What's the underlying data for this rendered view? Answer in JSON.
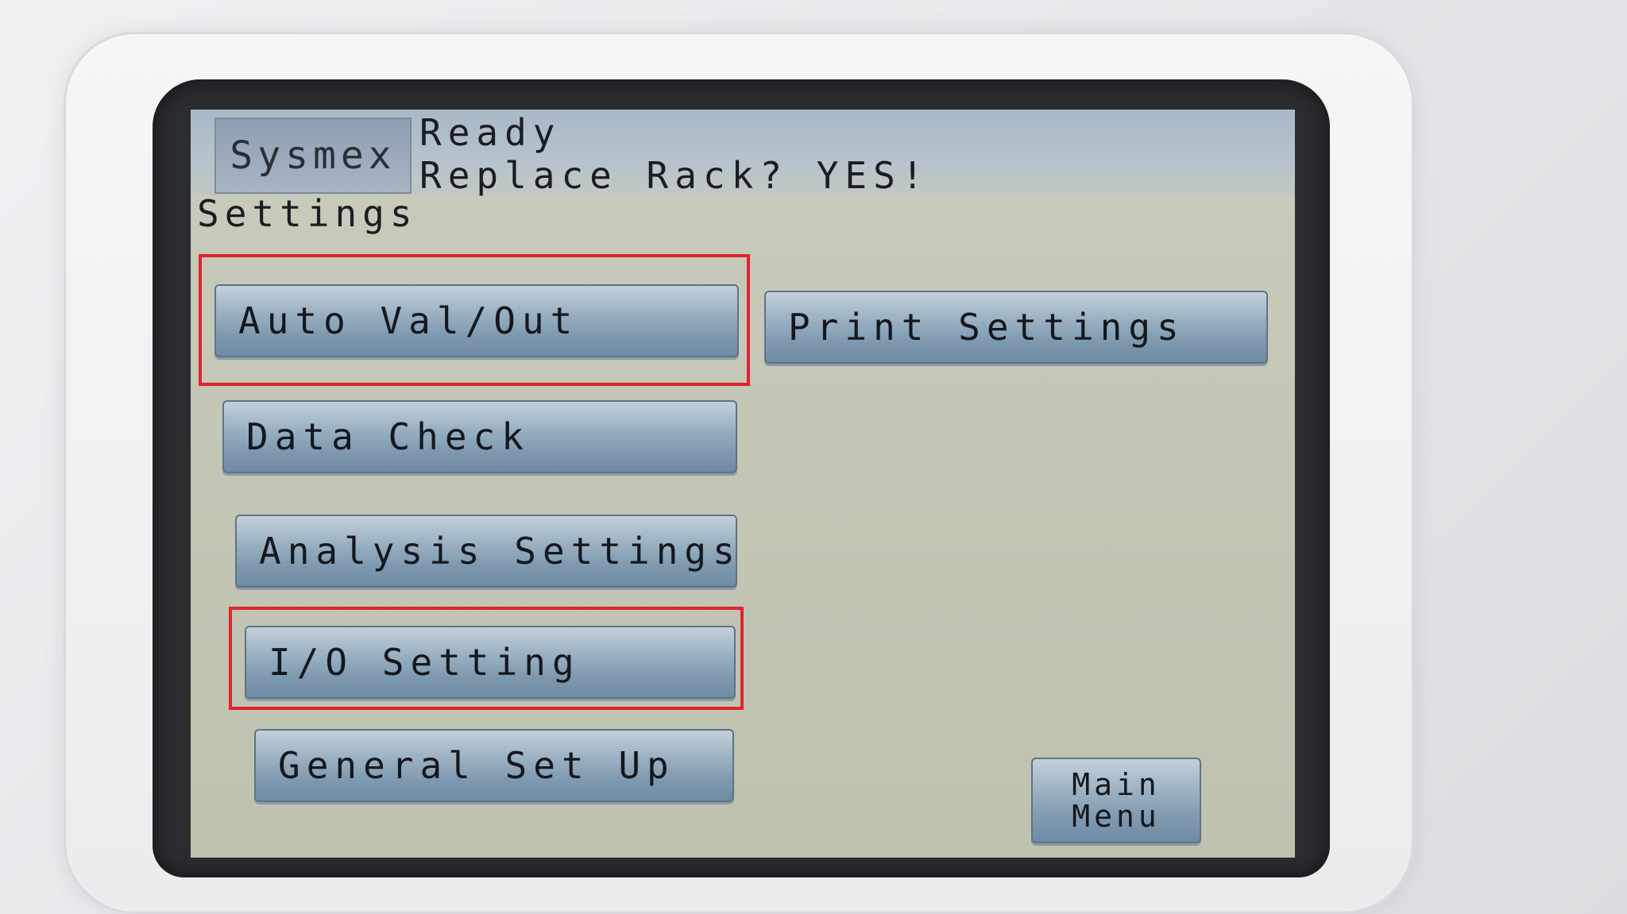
{
  "status_bar": {
    "brand": "Sysmex",
    "line1": "Ready",
    "line2": "Replace Rack? YES!"
  },
  "page_title": "Settings",
  "buttons": {
    "auto_val_out": "Auto Val/Out",
    "print_settings": "Print Settings",
    "data_check": "Data Check",
    "analysis_settings": "Analysis Settings",
    "io_setting": "I/O Setting",
    "general_set_up": "General Set Up",
    "main_menu_line1": "Main",
    "main_menu_line2": "Menu"
  },
  "annotation_color": "#e3232e"
}
